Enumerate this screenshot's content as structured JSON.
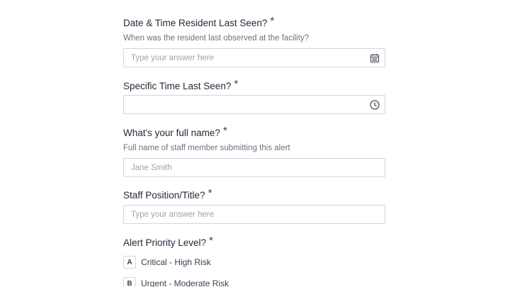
{
  "questions": {
    "date_seen": {
      "title": "Date & Time Resident Last Seen?",
      "required": "*",
      "description": "When was the resident last observed at the facility?",
      "placeholder": "Type your answer here",
      "icon": "calendar-icon"
    },
    "time_seen": {
      "title": "Specific Time Last Seen?",
      "required": "*",
      "value": "",
      "icon": "clock-icon"
    },
    "full_name": {
      "title": "What's your full name?",
      "required": "*",
      "description": "Full name of staff member submitting this alert",
      "placeholder": "Jane Smith"
    },
    "position": {
      "title": "Staff Position/Title?",
      "required": "*",
      "placeholder": "Type your answer here"
    },
    "priority": {
      "title": "Alert Priority Level?",
      "required": "*",
      "options": [
        {
          "key": "A",
          "label": "Critical - High Risk"
        },
        {
          "key": "B",
          "label": "Urgent - Moderate Risk"
        }
      ]
    }
  },
  "colors": {
    "border": "#d1d5db",
    "text": "#1f2937",
    "muted": "#6b7280",
    "placeholder": "#9ca3af"
  }
}
